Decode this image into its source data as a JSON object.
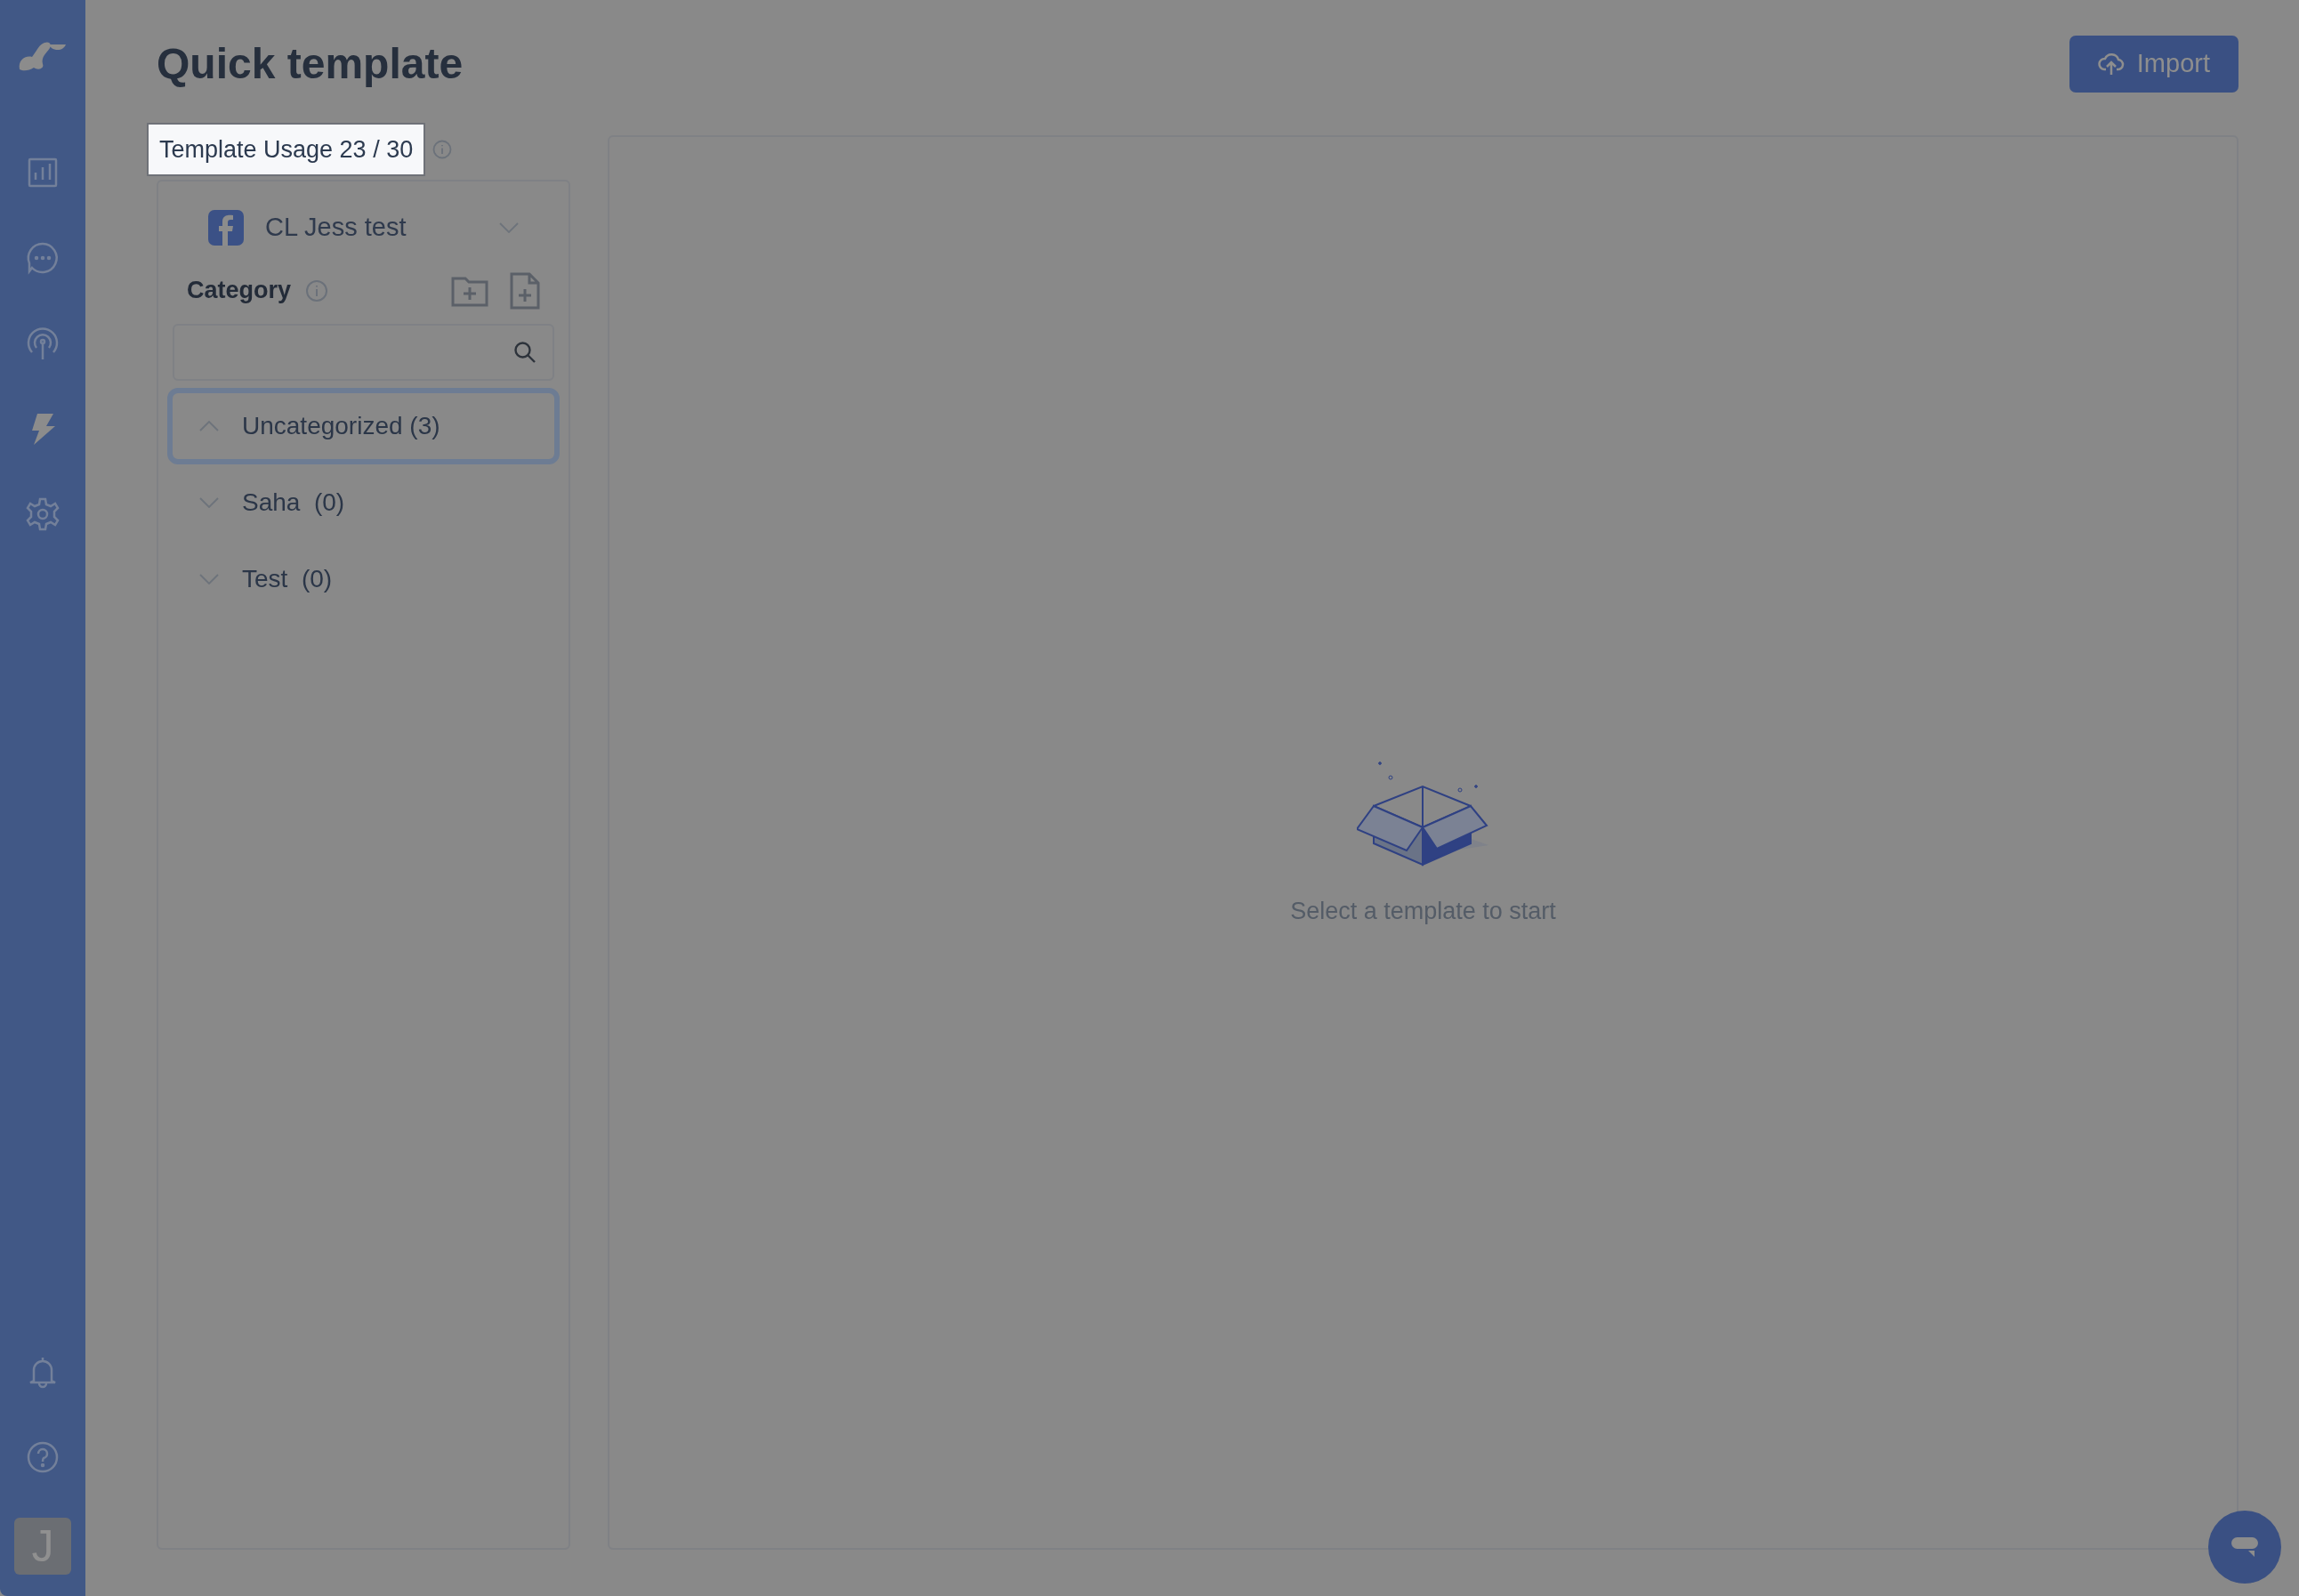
{
  "page": {
    "title": "Quick template",
    "import_button": "Import"
  },
  "sidebar": {
    "items": [
      {
        "kind": "chart"
      },
      {
        "kind": "chat"
      },
      {
        "kind": "broadcast"
      },
      {
        "kind": "bolt"
      },
      {
        "kind": "settings"
      }
    ],
    "bottom_items": [
      {
        "kind": "bell"
      },
      {
        "kind": "help"
      }
    ],
    "avatar": "J"
  },
  "usage": {
    "label": "Template Usage 23 / 30",
    "highlighted": true
  },
  "account": {
    "name": "CL Jess test"
  },
  "category": {
    "title": "Category"
  },
  "categories": [
    {
      "label": "Uncategorized (3)",
      "expanded": true,
      "selected": true
    },
    {
      "label": "Saha  (0)",
      "expanded": false,
      "selected": false
    },
    {
      "label": "Test  (0)",
      "expanded": false,
      "selected": false
    }
  ],
  "empty_state": {
    "message": "Select a template to start"
  }
}
